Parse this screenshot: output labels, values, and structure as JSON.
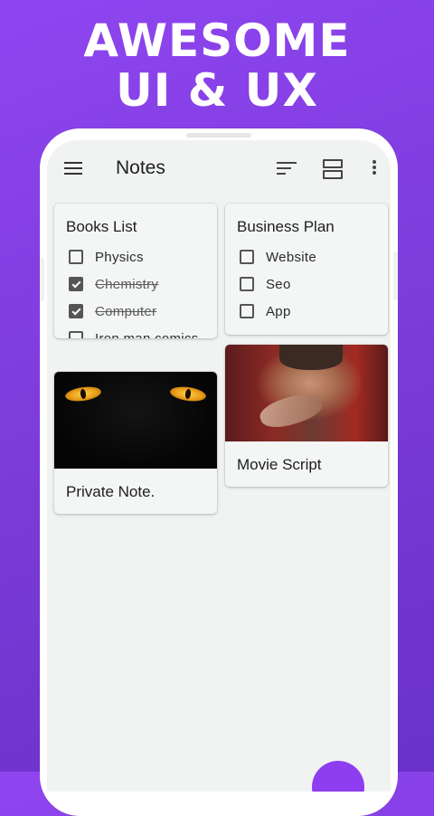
{
  "headline": {
    "line1": "AWESOME",
    "line2": "UI & UX"
  },
  "appbar": {
    "title": "Notes",
    "menu_icon": "hamburger-menu-icon",
    "sort_icon": "sort-icon",
    "layout_icon": "view-layout-icon",
    "more_icon": "more-vert-icon"
  },
  "notes": {
    "books": {
      "title": "Books List",
      "items": [
        {
          "label": "Physics",
          "checked": false
        },
        {
          "label": "Chemistry",
          "checked": true
        },
        {
          "label": "Computer",
          "checked": true
        },
        {
          "label": "Iron man comics",
          "checked": false
        }
      ]
    },
    "business": {
      "title": "Business Plan",
      "items": [
        {
          "label": "Website",
          "checked": false
        },
        {
          "label": "Seo",
          "checked": false
        },
        {
          "label": "App",
          "checked": false
        }
      ]
    },
    "private": {
      "title": "Private Note."
    },
    "movie": {
      "title": "Movie Script"
    }
  },
  "colors": {
    "background": "#8f45f0",
    "fab": "#8e3ef0",
    "screen": "#f1f3f3"
  }
}
